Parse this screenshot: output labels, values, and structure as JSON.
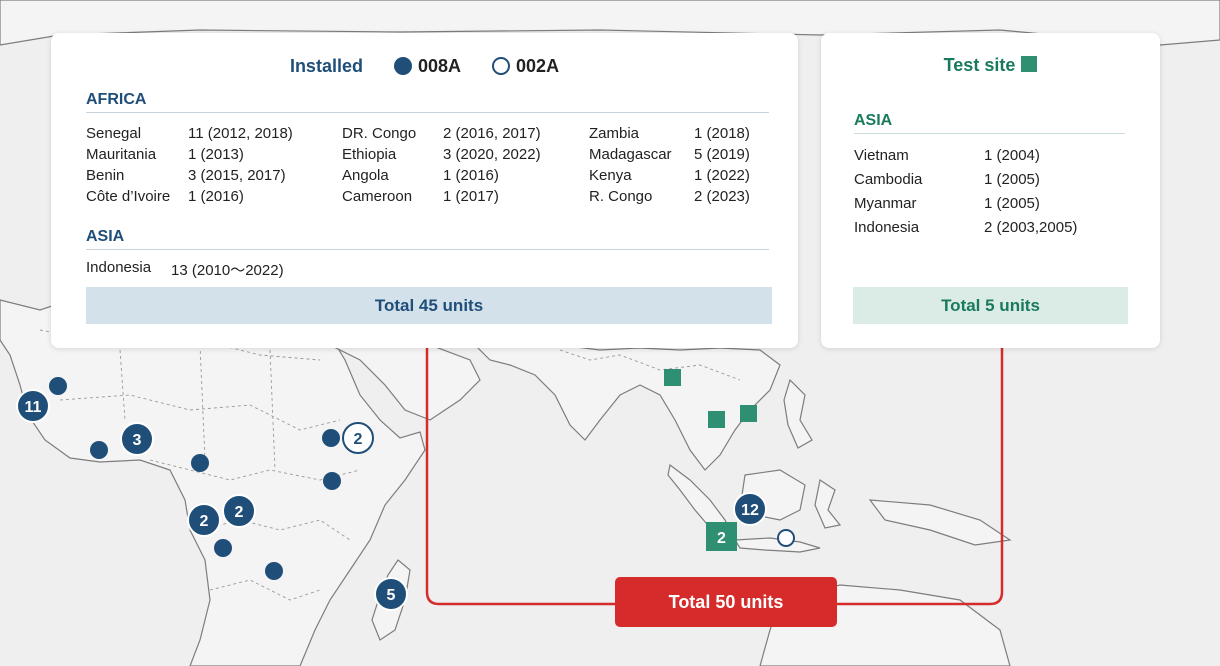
{
  "installed_panel": {
    "title": "Installed",
    "legend": [
      {
        "symbol": "filled-circle",
        "label": "008A"
      },
      {
        "symbol": "open-circle",
        "label": "002A"
      }
    ],
    "africa": {
      "heading": "AFRICA",
      "columns": [
        [
          {
            "country": "Senegal",
            "value": "11 (2012, 2018)"
          },
          {
            "country": "Mauritania",
            "value": "1 (2013)"
          },
          {
            "country": "Benin",
            "value": "3 (2015, 2017)"
          },
          {
            "country": "Côte d’Ivoire",
            "value": "1 (2016)"
          }
        ],
        [
          {
            "country": "DR. Congo",
            "value": "2 (2016, 2017)"
          },
          {
            "country": "Ethiopia",
            "value": "3 (2020, 2022)"
          },
          {
            "country": "Angola",
            "value": "1 (2016)"
          },
          {
            "country": "Cameroon",
            "value": "1 (2017)"
          }
        ],
        [
          {
            "country": "Zambia",
            "value": "1 (2018)"
          },
          {
            "country": "Madagascar",
            "value": "5 (2019)"
          },
          {
            "country": "Kenya",
            "value": "1 (2022)"
          },
          {
            "country": "R. Congo",
            "value": "2 (2023)"
          }
        ]
      ]
    },
    "asia": {
      "heading": "ASIA",
      "rows": [
        {
          "country": "Indonesia",
          "value": "13 (2010〜2022)"
        }
      ]
    },
    "total": "Total 45 units"
  },
  "test_panel": {
    "title": "Test site",
    "asia": {
      "heading": "ASIA",
      "rows": [
        {
          "country": "Vietnam",
          "value": "1 (2004)"
        },
        {
          "country": "Cambodia",
          "value": "1 (2005)"
        },
        {
          "country": "Myanmar",
          "value": "1 (2005)"
        },
        {
          "country": "Indonesia",
          "value": "2 (2003,2005)"
        }
      ]
    },
    "total": "Total 5 units"
  },
  "map_markers": {
    "senegal": "11",
    "benin": "3",
    "ethiopia_002a": "2",
    "rcongo": "2",
    "drcongo": "2",
    "madagascar": "5",
    "indonesia_installed": "12",
    "indonesia_test": "2"
  },
  "grand_total": "Total 50 units",
  "colors": {
    "installed_marker": "#1f4e79",
    "test_marker": "#2f8f72",
    "total_badge": "#d62b2b",
    "bracket_line": "#d62b2b"
  }
}
